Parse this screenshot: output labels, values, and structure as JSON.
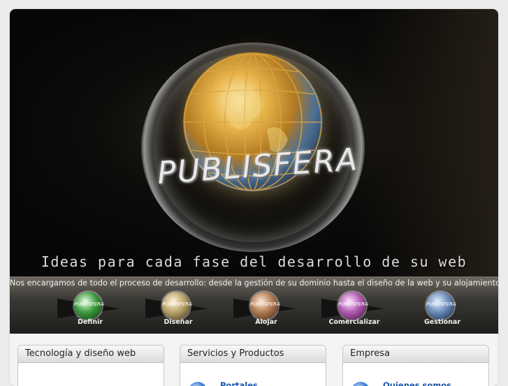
{
  "hero": {
    "brand": "PUBLISFERA",
    "tagline": "Ideas para cada fase del desarrollo de su web"
  },
  "process": {
    "intro": "Nos encargamos de todo el proceso de desarrollo:  desde la gestión de su dominio hasta el diseño de la web y su alojamiento",
    "ball_text": "PUBLISFERA",
    "steps": [
      {
        "label": "Definir",
        "color": "#3c9a3c"
      },
      {
        "label": "Diseñar",
        "color": "#b8a26a"
      },
      {
        "label": "Alojar",
        "color": "#b07a52"
      },
      {
        "label": "Comercializar",
        "color": "#b05ab0"
      },
      {
        "label": "Gestionar",
        "color": "#6a8ab8"
      }
    ]
  },
  "panels": [
    {
      "title": "Tecnología y diseño web",
      "link": ""
    },
    {
      "title": "Servicios y Productos",
      "link": "Portales"
    },
    {
      "title": "Empresa",
      "link": "Quienes somos"
    }
  ]
}
